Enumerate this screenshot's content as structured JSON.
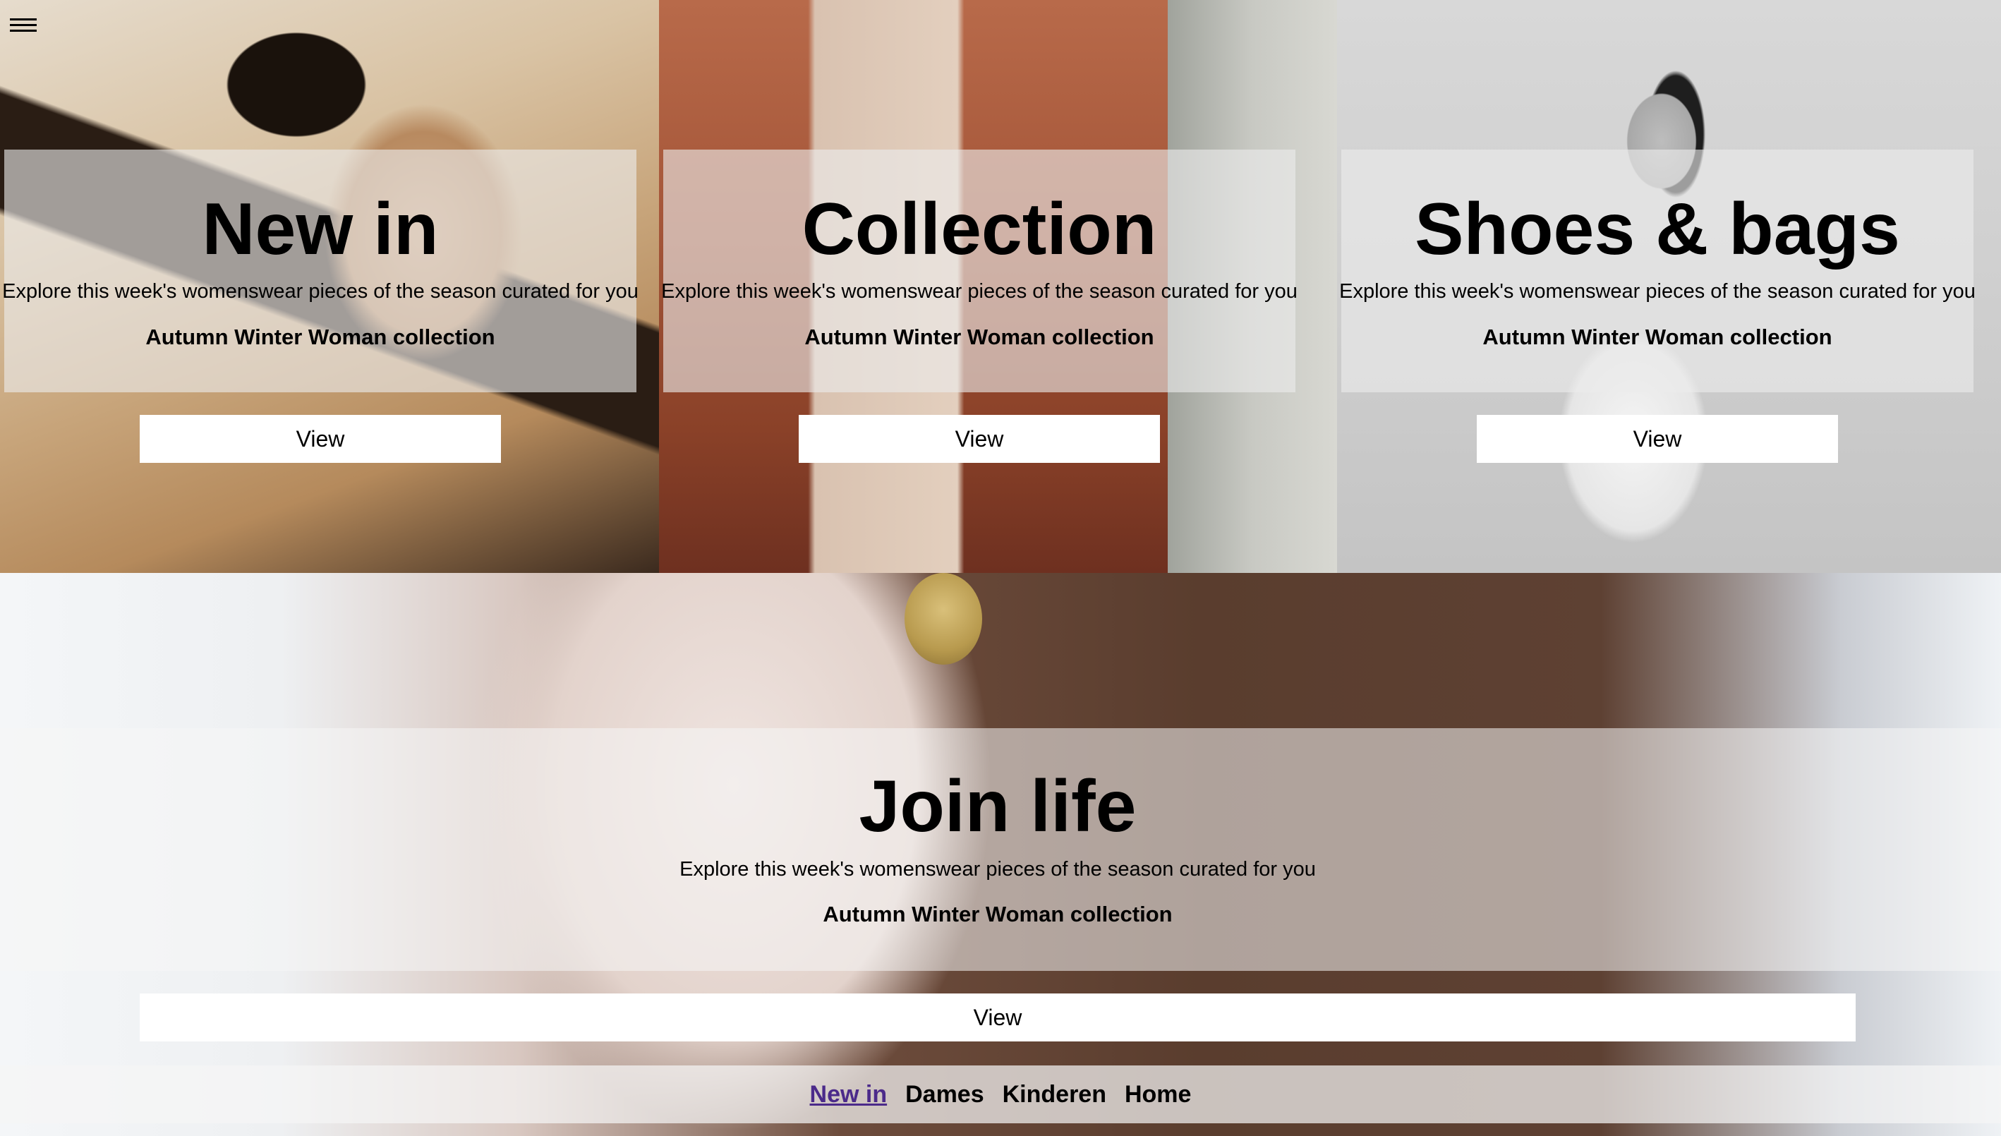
{
  "menu": {
    "icon": "hamburger-menu-icon"
  },
  "tiles": [
    {
      "heading": "New in",
      "description": "Explore this week's womenswear pieces of the season curated for you",
      "collection": "Autumn Winter Woman collection",
      "button_label": "View"
    },
    {
      "heading": "Collection",
      "description": "Explore this week's womenswear pieces of the season curated for you",
      "collection": "Autumn Winter Woman collection",
      "button_label": "View"
    },
    {
      "heading": "Shoes & bags",
      "description": "Explore this week's womenswear pieces of the season curated for you",
      "collection": "Autumn Winter Woman collection",
      "button_label": "View"
    }
  ],
  "banner": {
    "heading": "Join life",
    "description": "Explore this week's womenswear pieces of the season curated for you",
    "collection": "Autumn Winter Woman collection",
    "button_label": "View"
  },
  "bottom_nav": {
    "items": [
      {
        "label": "New in",
        "active": true
      },
      {
        "label": "Dames",
        "active": false
      },
      {
        "label": "Kinderen",
        "active": false
      },
      {
        "label": "Home",
        "active": false
      }
    ],
    "active_color": "#4b2a8a"
  }
}
